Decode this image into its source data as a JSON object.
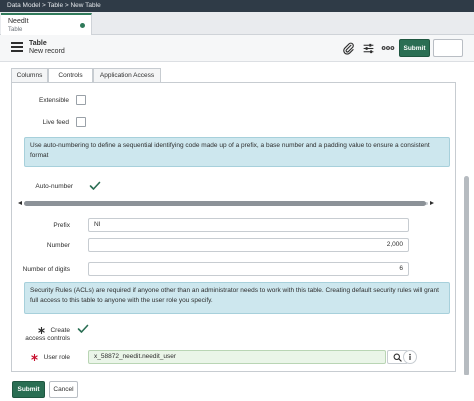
{
  "breadcrumb": "Data Model > Table > New Table",
  "doc_tab": {
    "title": "NeedIt",
    "subtitle": "Table"
  },
  "header": {
    "title": "Table",
    "subtitle": "New record",
    "submit_label": "Submit"
  },
  "tabs": [
    {
      "label": "Columns",
      "active": false
    },
    {
      "label": "Controls",
      "active": true
    },
    {
      "label": "Application Access",
      "active": false
    }
  ],
  "form": {
    "extensible": {
      "label": "Extensible",
      "checked": false
    },
    "live_feed": {
      "label": "Live feed",
      "checked": false
    },
    "auto_number_info": "Use auto-numbering to define a sequential identifying code made up of a prefix, a base number and a padding value to ensure a consistent format",
    "auto_number": {
      "label": "Auto-number",
      "checked": true
    },
    "prefix": {
      "label": "Prefix",
      "value": "NI"
    },
    "number": {
      "label": "Number",
      "value": "2,000"
    },
    "number_of_digits": {
      "label": "Number of digits",
      "value": "6"
    },
    "security_info": "Security Rules (ACLs) are required if anyone other than an administrator needs to work with this table. Creating default security rules will grant full access to this table to anyone with the user role you specify.",
    "create_access_controls": {
      "label_line1": "Create",
      "label_line2": "access controls",
      "checked": true
    },
    "user_role": {
      "label": "User role",
      "value": "x_58872_needit.needit_user"
    }
  },
  "footer": {
    "submit_label": "Submit",
    "cancel_label": "Cancel"
  },
  "colors": {
    "topbar": "#2f3b47",
    "accent_green": "#2a6e53",
    "info_bg": "#cde7ee",
    "required_red": "#c8102e",
    "reference_bg": "#eaf5e8",
    "checkmark": "#2a6e53"
  },
  "icons": {
    "menu": "hamburger-menu-icon",
    "attachment": "paperclip-icon",
    "settings": "sliders-icon",
    "more": "more-options-icon",
    "required": "asterisk-icon",
    "lookup": "search-icon",
    "info": "info-icon"
  }
}
